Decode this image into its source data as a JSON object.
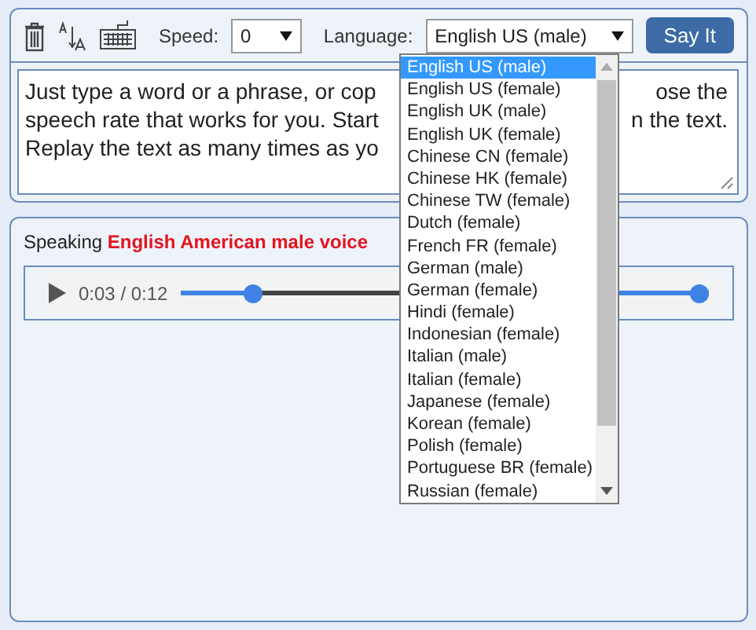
{
  "toolbar": {
    "speed_label": "Speed:",
    "speed_value": "0",
    "language_label": "Language:",
    "language_value": "English US (male)",
    "say_button": "Say It"
  },
  "text_lines": [
    {
      "left": "Just type a word or a phrase, or cop",
      "right": "ose the"
    },
    {
      "left": "speech rate that works for you. Start",
      "right": "n the text."
    },
    {
      "left": "Replay the text as many times as yo"
    }
  ],
  "status": {
    "prefix": "Speaking",
    "voice": "English American male voice"
  },
  "player": {
    "time": "0:03 / 0:12",
    "progress": {
      "level": 0.2
    },
    "volume": {
      "level": 1
    }
  },
  "language_menu": {
    "items": [
      {
        "label": "English US (male)",
        "selected": true
      },
      {
        "label": "English US (female)",
        "selected": false
      },
      {
        "label": "English UK (male)",
        "selected": false
      },
      {
        "label": "English UK (female)",
        "selected": false
      },
      {
        "label": "Chinese CN (female)",
        "selected": false
      },
      {
        "label": "Chinese HK (female)",
        "selected": false
      },
      {
        "label": "Chinese TW (female)",
        "selected": false
      },
      {
        "label": "Dutch (female)",
        "selected": false
      },
      {
        "label": "French FR (female)",
        "selected": false
      },
      {
        "label": "German (male)",
        "selected": false
      },
      {
        "label": "German (female)",
        "selected": false
      },
      {
        "label": "Hindi (female)",
        "selected": false
      },
      {
        "label": "Indonesian (female)",
        "selected": false
      },
      {
        "label": "Italian (male)",
        "selected": false
      },
      {
        "label": "Italian (female)",
        "selected": false
      },
      {
        "label": "Japanese (female)",
        "selected": false
      },
      {
        "label": "Korean (female)",
        "selected": false
      },
      {
        "label": "Polish (female)",
        "selected": false
      },
      {
        "label": "Portuguese BR (female)",
        "selected": false
      },
      {
        "label": "Russian (female)",
        "selected": false
      }
    ]
  }
}
